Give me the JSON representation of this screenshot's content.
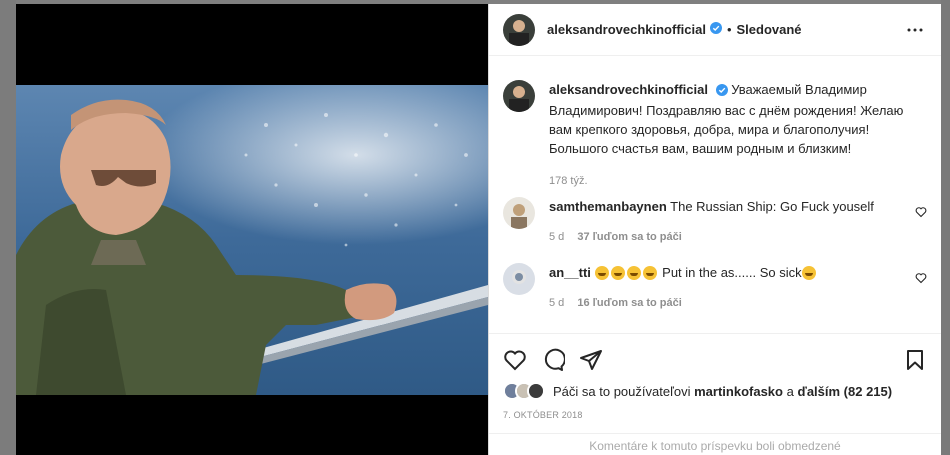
{
  "post": {
    "username": "aleksandrovechkinofficial",
    "follow_status": "Sledované",
    "caption": "Уважаемый Владимир Владимирович! Поздравляю вас с днём рождения! Желаю вам крепкого здоровья, добра, мира и благополучия! Большого счастья вам, вашим родным и близким!",
    "caption_age": "178 týž."
  },
  "comments": [
    {
      "username": "samthemanbaynen",
      "text_before": "The Russian Ship: Go Fuck youself",
      "text_after": "",
      "age": "5 d",
      "likes": "37 ľuďom sa to páči",
      "emoji_count": 0
    },
    {
      "username": "an__tti",
      "text_before": "Put in the as...... So sick",
      "text_after": "",
      "age": "5 d",
      "likes": "16 ľuďom sa to páči",
      "emoji_count": 4
    }
  ],
  "likes": {
    "prefix": "Páči sa to používateľovi",
    "user": "martinkofasko",
    "and": "a",
    "others": "ďalším (82 215)"
  },
  "date": "7. OKTÓBER 2018",
  "comments_limited": "Komentáre k tomuto príspevku boli obmedzené",
  "icons": {
    "verified": "verified-badge-icon",
    "more": "more-options-icon",
    "like": "heart-icon",
    "comment": "comment-icon",
    "share": "share-icon",
    "save": "bookmark-icon"
  },
  "colors": {
    "verified": "#3897f0",
    "text": "#262626",
    "secondary": "#8e8e8e"
  }
}
